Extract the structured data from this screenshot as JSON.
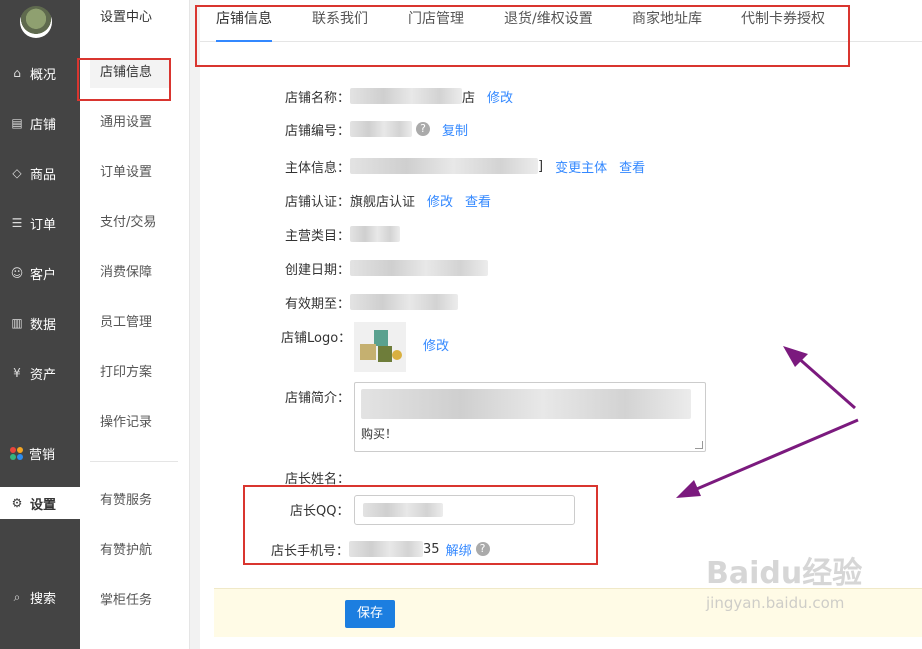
{
  "leftnav": {
    "items": [
      {
        "label": "概况",
        "icon": "overview-icon",
        "glyph": "⌂"
      },
      {
        "label": "店铺",
        "icon": "store-icon",
        "glyph": "▤"
      },
      {
        "label": "商品",
        "icon": "tag-icon",
        "glyph": "◇"
      },
      {
        "label": "订单",
        "icon": "order-icon",
        "glyph": "☰"
      },
      {
        "label": "客户",
        "icon": "customer-icon",
        "glyph": "☺"
      },
      {
        "label": "数据",
        "icon": "chart-icon",
        "glyph": "▥"
      },
      {
        "label": "资产",
        "icon": "yuan-icon",
        "glyph": "¥"
      },
      {
        "label": "营销",
        "icon": "marketing-icon",
        "glyph": ""
      },
      {
        "label": "设置",
        "icon": "gear-icon",
        "glyph": "⚙"
      },
      {
        "label": "搜索",
        "icon": "search-icon",
        "glyph": "⌕"
      }
    ],
    "active_label": "设置"
  },
  "submenu": {
    "title": "设置中心",
    "items": [
      "店铺信息",
      "通用设置",
      "订单设置",
      "支付/交易",
      "消费保障",
      "员工管理",
      "打印方案",
      "操作记录"
    ],
    "extra": [
      "有赞服务",
      "有赞护航",
      "掌柜任务"
    ]
  },
  "tabs": [
    "店铺信息",
    "联系我们",
    "门店管理",
    "退货/维权设置",
    "商家地址库",
    "代制卡券授权"
  ],
  "form": {
    "name": {
      "label": "店铺名称：",
      "tail": "店",
      "action": "修改"
    },
    "number": {
      "label": "店铺编号：",
      "help": "?",
      "action": "复制"
    },
    "entity": {
      "label": "主体信息：",
      "tail": "]",
      "action1": "变更主体",
      "action2": "查看"
    },
    "cert": {
      "label": "店铺认证：",
      "value": "旗舰店认证",
      "action1": "修改",
      "action2": "查看"
    },
    "category": {
      "label": "主营类目："
    },
    "created": {
      "label": "创建日期："
    },
    "expires": {
      "label": "有效期至："
    },
    "logo": {
      "label": "店铺Logo：",
      "action": "修改"
    },
    "intro": {
      "label": "店铺简介：",
      "tail_text": "购买！"
    },
    "owner_name": {
      "label": "店长姓名："
    },
    "owner_qq": {
      "label": "店长QQ："
    },
    "owner_phone": {
      "label": "店长手机号：",
      "tail": "35",
      "action": "解绑",
      "help": "?"
    }
  },
  "footer": {
    "save_label": "保存"
  },
  "watermark": {
    "brand": "Baidu经验",
    "domain": "jingyan.baidu.com"
  }
}
